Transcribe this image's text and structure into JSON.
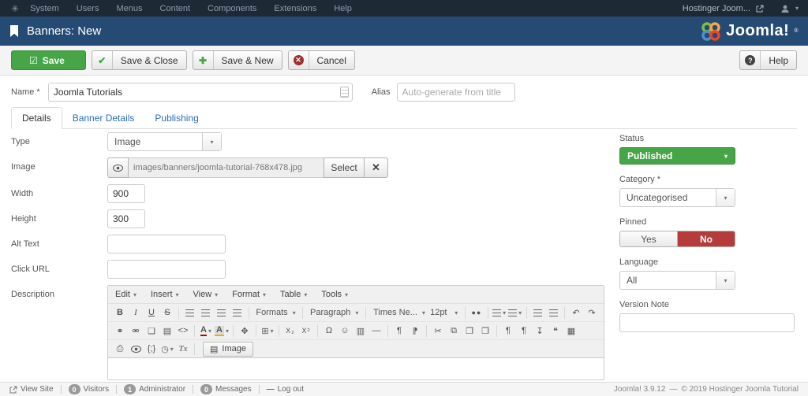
{
  "topbar": {
    "menu": [
      "System",
      "Users",
      "Menus",
      "Content",
      "Components",
      "Extensions",
      "Help"
    ],
    "site_link": "Hostinger Joom..."
  },
  "header": {
    "title": "Banners: New",
    "brand": "Joomla!",
    "brand_mark": "®"
  },
  "toolbar": {
    "save": "Save",
    "save_close": "Save & Close",
    "save_new": "Save & New",
    "cancel": "Cancel",
    "help": "Help"
  },
  "form": {
    "name_label": "Name *",
    "name_value": "Joomla Tutorials",
    "alias_label": "Alias",
    "alias_placeholder": "Auto-generate from title",
    "tabs": [
      "Details",
      "Banner Details",
      "Publishing"
    ],
    "type_label": "Type",
    "type_value": "Image",
    "image_label": "Image",
    "image_path": "images/banners/joomla-tutorial-768x478.jpg",
    "select_button": "Select",
    "width_label": "Width",
    "width_value": "900",
    "height_label": "Height",
    "height_value": "300",
    "alt_label": "Alt Text",
    "alt_value": "",
    "click_label": "Click URL",
    "click_value": "",
    "description_label": "Description"
  },
  "editor": {
    "menu": [
      "Edit",
      "Insert",
      "View",
      "Format",
      "Table",
      "Tools"
    ],
    "formats": "Formats",
    "paragraph": "Paragraph",
    "font": "Times Ne...",
    "size": "12pt",
    "image_button": "Image"
  },
  "sidebar": {
    "status_label": "Status",
    "status_value": "Published",
    "category_label": "Category *",
    "category_value": "Uncategorised",
    "pinned_label": "Pinned",
    "yes": "Yes",
    "no": "No",
    "language_label": "Language",
    "language_value": "All",
    "version_label": "Version Note",
    "version_value": ""
  },
  "footer": {
    "view_site": "View Site",
    "visitors_count": "0",
    "visitors": "Visitors",
    "admin_count": "1",
    "admin": "Administrator",
    "messages_count": "0",
    "messages": "Messages",
    "logout": "Log out",
    "version": "Joomla! 3.9.12",
    "sep": "—",
    "copyright": "© 2019 Hostinger Joomla Tutorial"
  },
  "icons": {
    "joomla": "✳",
    "caret": "▾",
    "check_square": "☑",
    "check": "✔",
    "plus": "✚",
    "cross": "✕",
    "question": "?",
    "bold": "B",
    "italic": "I",
    "underline": "U",
    "strike": "S",
    "search": "●●",
    "undo": "↶",
    "redo": "↷",
    "link": "⚭",
    "unlink": "⚮",
    "anchor": "❏",
    "image": "▤",
    "code": "<>",
    "fontcolor": "A",
    "bgcolor": "A",
    "fullscreen": "✥",
    "table": "⊞",
    "subscript": "X₂",
    "superscript": "X²",
    "omega": "Ω",
    "smiley": "☺",
    "media": "▥",
    "hr": "—",
    "ltr": "¶",
    "rtl": "⁋",
    "cut": "✂",
    "copy": "⧉",
    "paste": "❐",
    "paste_text": "❒",
    "vischars": "¶",
    "visblocks": "¶",
    "pagebreak": "↧",
    "quote": "❝",
    "template": "▦",
    "print": "⎙",
    "codesample": "{;}",
    "clock": "◷",
    "removeformat": "Tx",
    "logout": "—"
  },
  "colors": {
    "topbar": "#1d2a36",
    "header_blue": "#254a73",
    "accent_green": "#46a546",
    "accent_red": "#b53c3b",
    "link_blue": "#2a6ebb"
  }
}
